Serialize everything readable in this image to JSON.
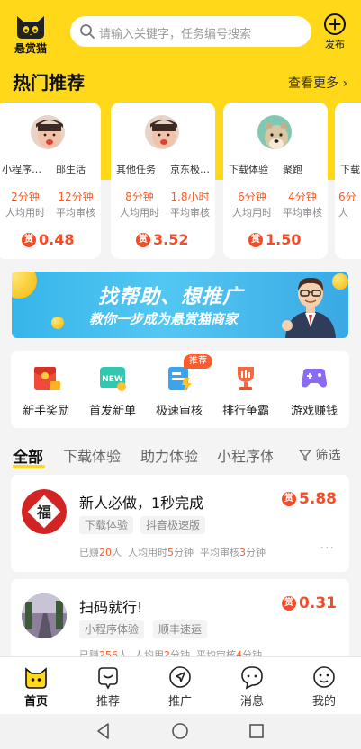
{
  "header": {
    "app_name": "悬赏猫",
    "search_placeholder": "请输入关键字，任务编号搜索",
    "publish_label": "发布",
    "accent_color": "#ffd81a"
  },
  "hot": {
    "title": "热门推荐",
    "more_label": "查看更多",
    "cards": [
      {
        "tag1": "小程序…",
        "tag2": "邮生活",
        "avg_time": "2分钟",
        "avg_time_label": "人均用时",
        "review": "12分钟",
        "review_label": "平均审核",
        "reward": "0.48",
        "avatar": "kid-avatar"
      },
      {
        "tag1": "其他任务",
        "tag2": "京东极…",
        "avg_time": "8分钟",
        "avg_time_label": "人均用时",
        "review": "1.8小时",
        "review_label": "平均审核",
        "reward": "3.52",
        "avatar": "kid-avatar"
      },
      {
        "tag1": "下载体验",
        "tag2": "聚跑",
        "avg_time": "6分钟",
        "avg_time_label": "人均用时",
        "review": "4分钟",
        "review_label": "平均审核",
        "reward": "1.50",
        "avatar": "dog-avatar"
      },
      {
        "tag1": "下载",
        "tag2": "",
        "avg_time": "6分",
        "avg_time_label": "人",
        "review": "",
        "review_label": "",
        "reward": "",
        "avatar": ""
      }
    ],
    "coin_glyph": "赏"
  },
  "banner": {
    "line1": "找帮助、想推广",
    "line2": "教你一步成为悬赏猫商家"
  },
  "quick": {
    "items": [
      {
        "label": "新手奖励",
        "icon": "red-envelope-icon"
      },
      {
        "label": "首发新单",
        "icon": "new-tag-icon"
      },
      {
        "label": "极速审核",
        "icon": "fast-review-icon"
      },
      {
        "label": "排行争霸",
        "icon": "trophy-icon"
      },
      {
        "label": "游戏赚钱",
        "icon": "gamepad-icon"
      }
    ],
    "badge": "推荐"
  },
  "tabs": {
    "items": [
      "全部",
      "下载体验",
      "助力体验",
      "小程序体"
    ],
    "filter_label": "筛选"
  },
  "tasks": [
    {
      "title": "新人必做，1秒完成",
      "tags": [
        "下载体验",
        "抖音极速版"
      ],
      "reward": "5.88",
      "earned_prefix": "已赚",
      "earned": "20",
      "earned_suffix": "人",
      "avg_prefix": "人均用时",
      "avg": "5",
      "avg_suffix": "分钟",
      "review_prefix": "平均审核",
      "review": "3",
      "review_suffix": "分钟",
      "more": "···"
    },
    {
      "title": "扫码就行!",
      "tags": [
        "小程序体验",
        "顺丰速运"
      ],
      "reward": "0.31",
      "earned_prefix": "已赚",
      "earned": "256",
      "earned_suffix": "人",
      "avg_prefix": "人均用",
      "avg": "2",
      "avg_suffix": "分钟",
      "review_prefix": "平均审核",
      "review": "4",
      "review_suffix": "分钟",
      "more": "···"
    }
  ],
  "bottom_nav": {
    "items": [
      {
        "label": "首页",
        "icon": "home-cat-icon",
        "active": true
      },
      {
        "label": "推荐",
        "icon": "recommend-icon",
        "active": false
      },
      {
        "label": "推广",
        "icon": "promote-icon",
        "active": false
      },
      {
        "label": "消息",
        "icon": "message-icon",
        "active": false
      },
      {
        "label": "我的",
        "icon": "profile-icon",
        "active": false
      }
    ]
  }
}
